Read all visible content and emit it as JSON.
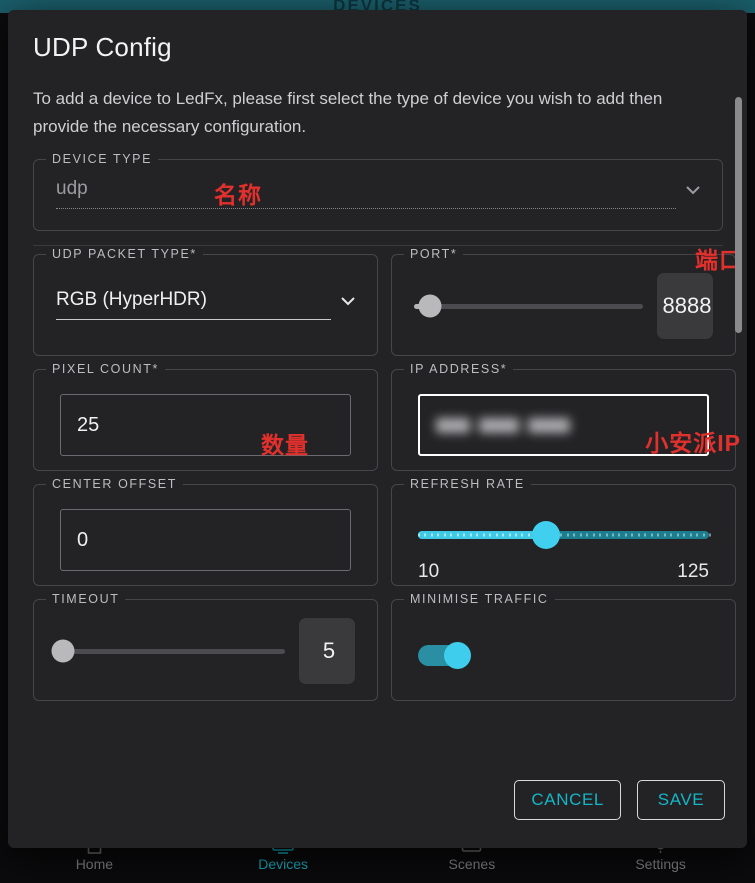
{
  "background": {
    "topbar_title": "DEVICES",
    "accent_teal": "#1b5f6b",
    "nav": [
      {
        "label": "Home",
        "icon": "home-icon",
        "active": false
      },
      {
        "label": "Devices",
        "icon": "devices-icon",
        "active": true
      },
      {
        "label": "Scenes",
        "icon": "scenes-icon",
        "active": false
      },
      {
        "label": "Settings",
        "icon": "settings-icon",
        "active": false
      }
    ]
  },
  "dialog": {
    "title": "UDP Config",
    "description": "To add a device to LedFx, please first select the type of device you wish to add then provide the necessary configuration.",
    "device_type": {
      "legend": "DEVICE TYPE",
      "value": "udp",
      "arrow_icon": "chevron-down-icon",
      "annotation": "名称"
    },
    "udp_packet_type": {
      "legend": "UDP PACKET TYPE*",
      "value": "RGB (HyperHDR)",
      "arrow_icon": "chevron-down-icon"
    },
    "port": {
      "legend": "PORT*",
      "value": "8888",
      "slider_percent": 7,
      "annotation": "端口"
    },
    "pixel_count": {
      "legend": "PIXEL COUNT*",
      "value": "25",
      "annotation": "数量"
    },
    "ip_address": {
      "legend": "IP ADDRESS*",
      "value": "",
      "redacted": true,
      "annotation": "小安派IP"
    },
    "center_offset": {
      "legend": "CENTER OFFSET",
      "value": "0"
    },
    "refresh_rate": {
      "legend": "REFRESH RATE",
      "min_label": "10",
      "max_label": "125",
      "slider_percent": 44,
      "accent": "#3ecdec"
    },
    "timeout": {
      "legend": "TIMEOUT",
      "value": "5",
      "slider_percent": 3
    },
    "minimise_traffic": {
      "legend": "MINIMISE TRAFFIC",
      "enabled": true,
      "accent": "#3ecdec"
    },
    "buttons": {
      "cancel": "CANCEL",
      "save": "SAVE"
    }
  }
}
